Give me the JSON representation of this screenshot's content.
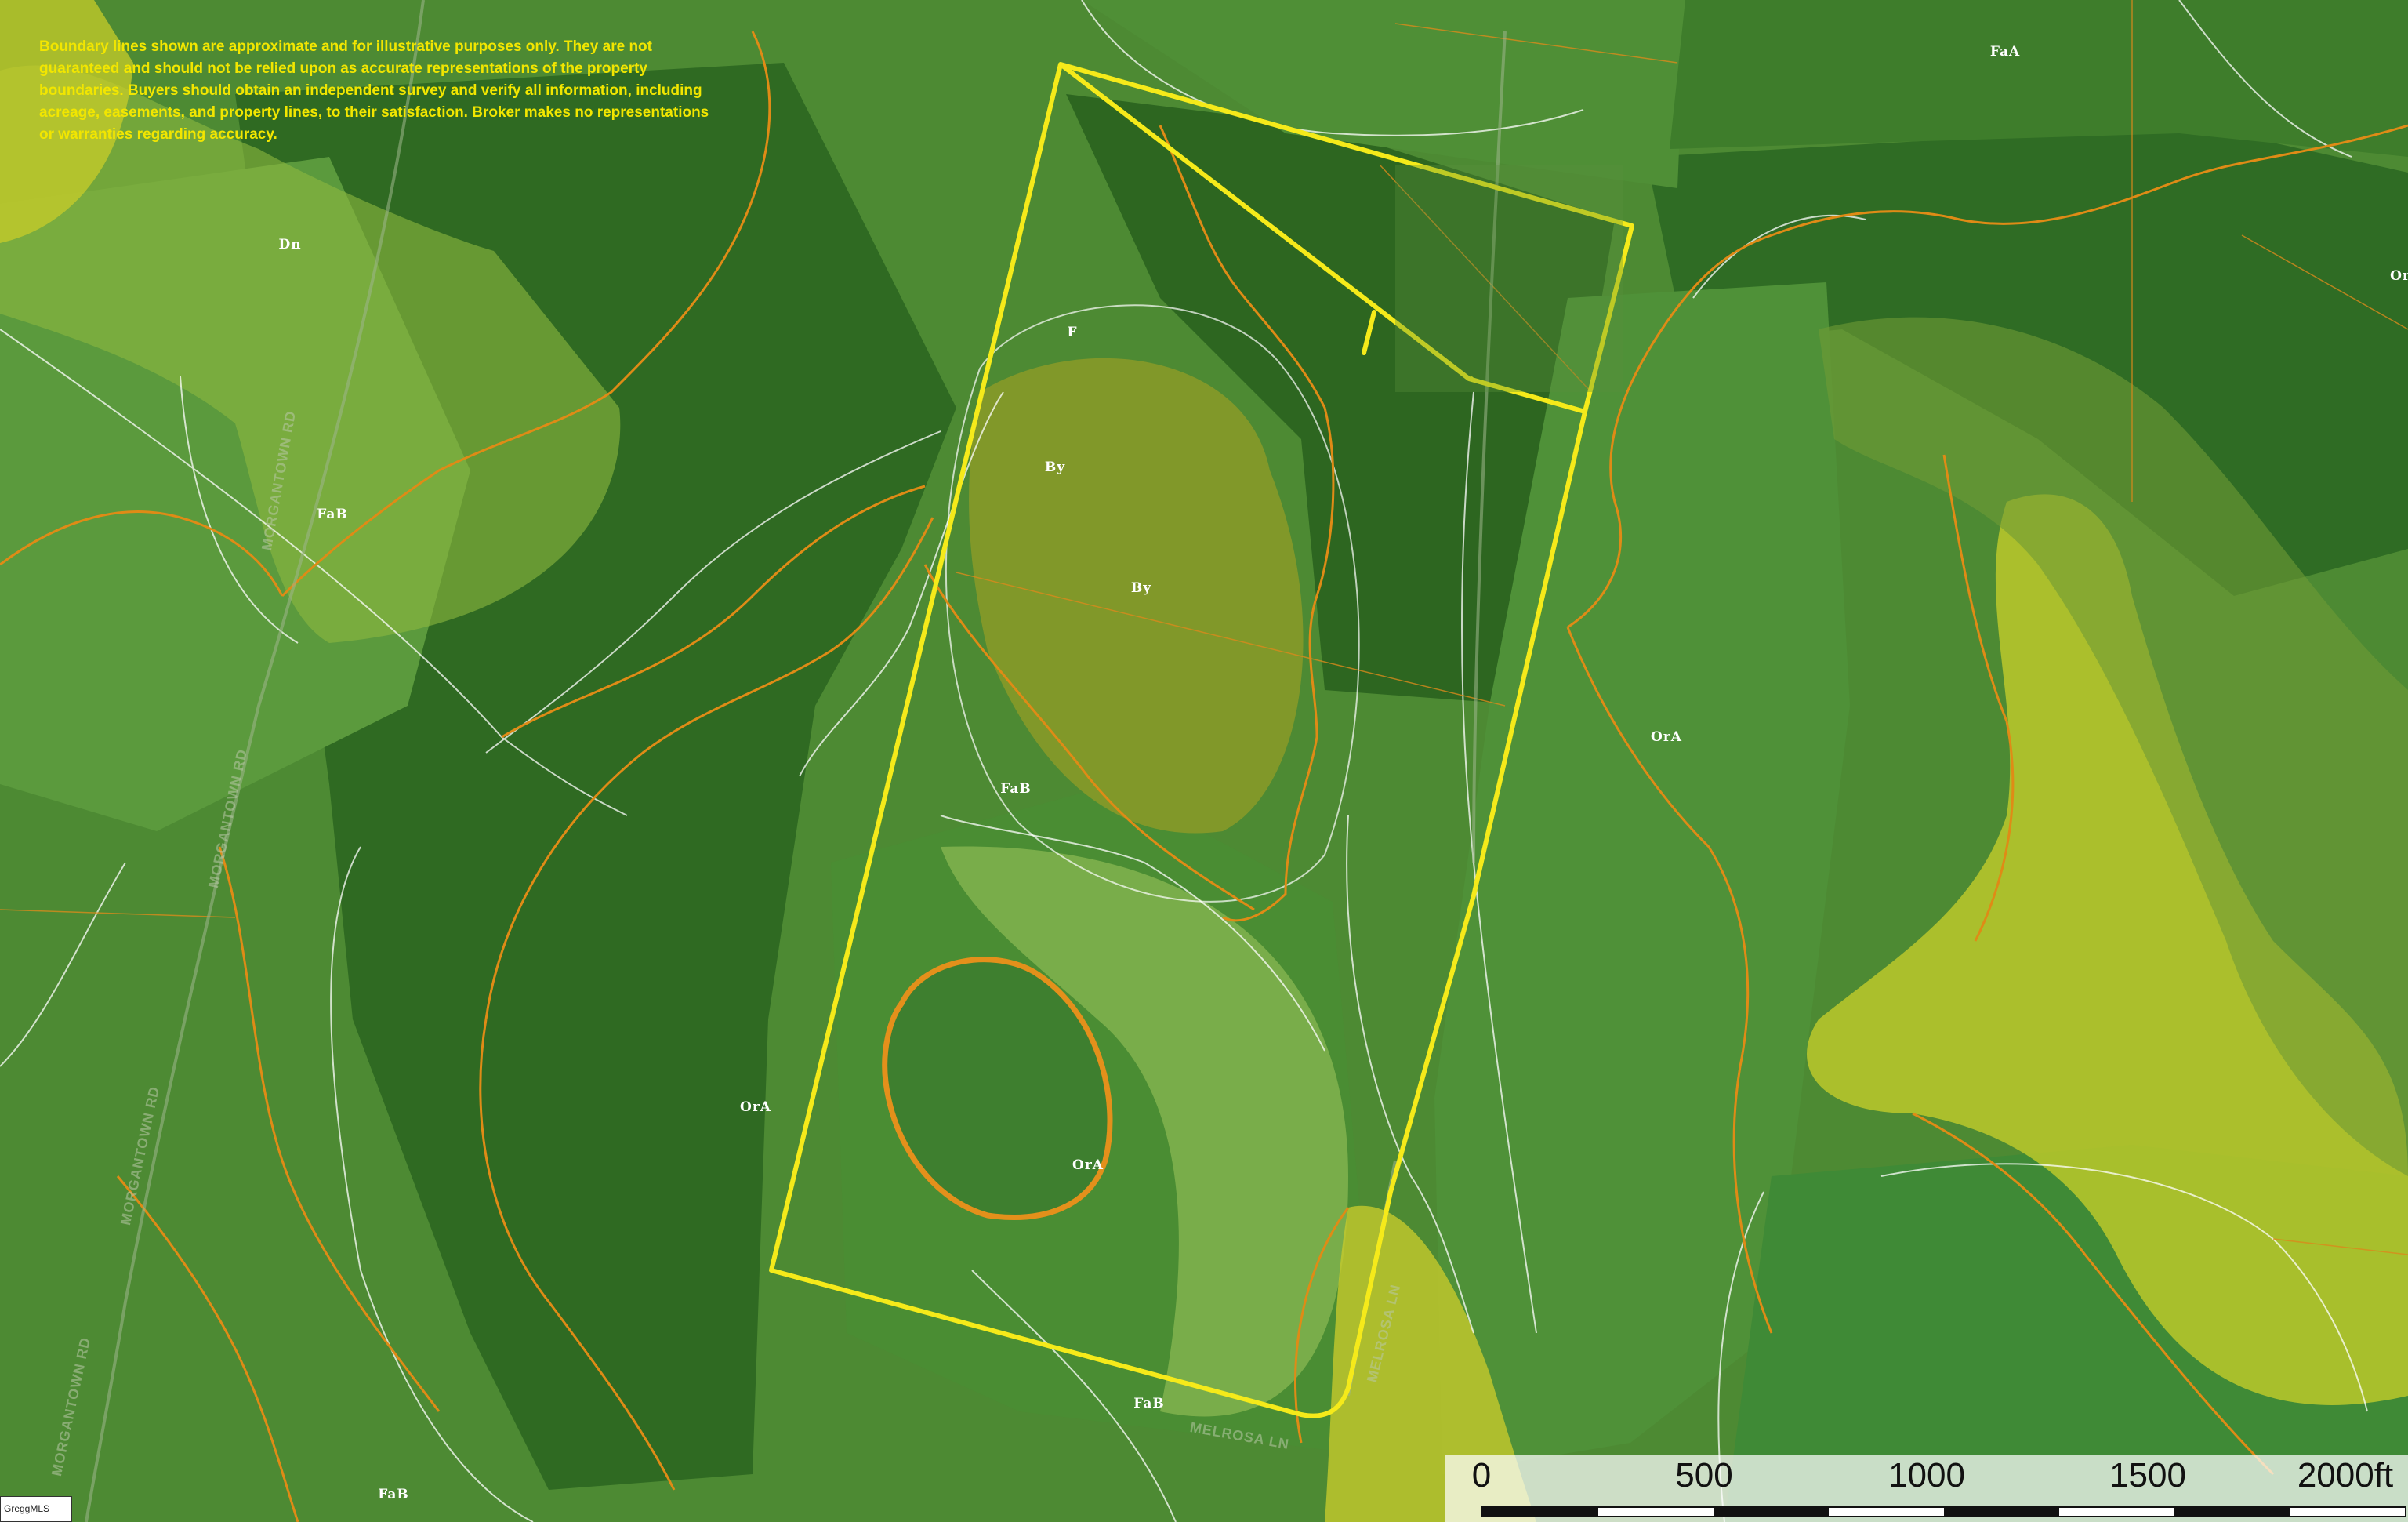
{
  "disclaimer": "Boundary lines shown are approximate and for illustrative purposes only. They are not guaranteed and should not be relied upon as accurate representations of the property boundaries. Buyers should obtain an independent survey and verify all information, including acreage, easements, and property lines, to their satisfaction. Broker makes no representations or warranties regarding accuracy.",
  "soil_labels": [
    "FaA",
    "Dn",
    "FaB",
    "F",
    "By",
    "By",
    "FaB",
    "OrA",
    "OrA",
    "OrA",
    "FaB",
    "FaB",
    "Or"
  ],
  "road_labels": [
    "MORGANTOWN RD",
    "MORGANTOWN RD",
    "MORGANTOWN RD",
    "MORGANTOWN RD",
    "MELROSA LN",
    "MELROSA LN"
  ],
  "scale": {
    "ticks": [
      "0",
      "500",
      "1000",
      "1500",
      "2000ft"
    ]
  },
  "logo_text": "GreggMLS",
  "colors": {
    "parcel_boundary": "#f5ea1a",
    "soil_line": "#e08a12",
    "disclaimer_text": "#f2e600",
    "label_text": "#ffffff"
  }
}
